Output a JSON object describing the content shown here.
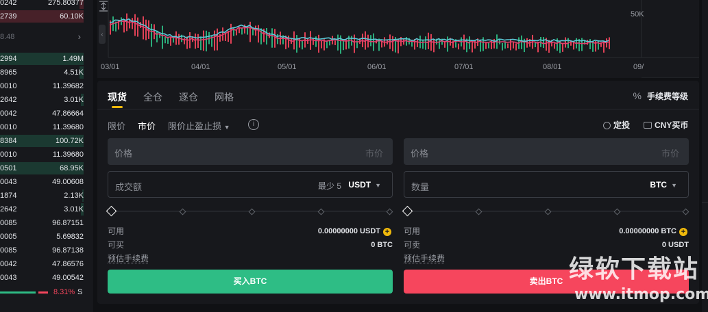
{
  "orderbook": {
    "asks": [
      {
        "price": "0242",
        "qty": "275.80377",
        "depth": 0.05
      },
      {
        "price": "2739",
        "qty": "60.10K",
        "depth": 1.0
      }
    ],
    "mid": {
      "price": "8.48"
    },
    "bids": [
      {
        "price": "2994",
        "qty": "1.49M",
        "depth": 1.0
      },
      {
        "price": "8965",
        "qty": "4.51K",
        "depth": 0.05
      },
      {
        "price": "0010",
        "qty": "11.39682",
        "depth": 0.0
      },
      {
        "price": "2642",
        "qty": "3.01K",
        "depth": 0.03
      },
      {
        "price": "0042",
        "qty": "47.86664",
        "depth": 0.0
      },
      {
        "price": "0010",
        "qty": "11.39680",
        "depth": 0.0
      },
      {
        "price": "8384",
        "qty": "100.72K",
        "depth": 1.0
      },
      {
        "price": "0010",
        "qty": "11.39680",
        "depth": 0.0
      },
      {
        "price": "0501",
        "qty": "68.95K",
        "depth": 1.0
      },
      {
        "price": "0043",
        "qty": "49.00608",
        "depth": 0.0
      },
      {
        "price": "1874",
        "qty": "2.13K",
        "depth": 0.02
      },
      {
        "price": "2642",
        "qty": "3.01K",
        "depth": 0.03
      },
      {
        "price": "0085",
        "qty": "96.87151",
        "depth": 0.0
      },
      {
        "price": "0005",
        "qty": "5.69832",
        "depth": 0.0
      },
      {
        "price": "0085",
        "qty": "96.87138",
        "depth": 0.0
      },
      {
        "price": "0042",
        "qty": "47.86576",
        "depth": 0.0
      },
      {
        "price": "0043",
        "qty": "49.00542",
        "depth": 0.0
      }
    ],
    "ratio_pct": "8.31%",
    "ratio_side": "S"
  },
  "chart": {
    "x_labels": [
      "03/01",
      "04/01",
      "05/01",
      "06/01",
      "07/01",
      "08/01",
      "09/"
    ],
    "y_label": "50K"
  },
  "trade": {
    "tabs": [
      {
        "label": "现货",
        "active": true
      },
      {
        "label": "全仓",
        "active": false
      },
      {
        "label": "逐仓",
        "active": false
      },
      {
        "label": "网格",
        "active": false
      }
    ],
    "fee_level_label": "手续费等级",
    "fee_level_icon": "%",
    "order_types": [
      {
        "label": "限价",
        "active": false
      },
      {
        "label": "市价",
        "active": true
      },
      {
        "label": "限价止盈止损",
        "active": false
      }
    ],
    "info_icon": "i",
    "dca_label": "定投",
    "cny_label": "CNY买币",
    "buy": {
      "price_label": "价格",
      "price_hint": "市价",
      "amount_label": "成交额",
      "min_label": "最少 5",
      "amount_unit": "USDT",
      "available_label": "可用",
      "available_value": "0.00000000 USDT",
      "buyable_label": "可买",
      "buyable_value": "0 BTC",
      "fee_label": "预估手续费",
      "button_label": "买入BTC"
    },
    "sell": {
      "price_label": "价格",
      "price_hint": "市价",
      "amount_label": "数量",
      "amount_unit": "BTC",
      "available_label": "可用",
      "available_value": "0.00000000 BTC",
      "sellable_label": "可卖",
      "sellable_value": "0 USDT",
      "fee_label": "预估手续费",
      "button_label": "卖出BTC"
    }
  },
  "watermark": {
    "logo": "绿软下载站",
    "url": "www.itmop.com"
  },
  "colors": {
    "buy": "#2ebd85",
    "sell": "#f6465d",
    "accent": "#f0b90b",
    "panel": "#17181c",
    "bg": "#101114"
  }
}
